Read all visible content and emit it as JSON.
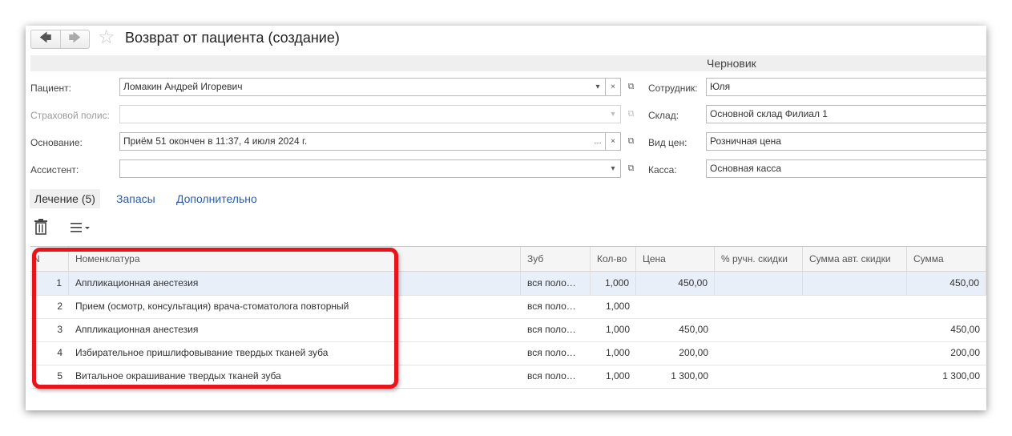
{
  "header": {
    "title": "Возврат от пациента (создание)",
    "status": "Черновик"
  },
  "form": {
    "patient": {
      "label": "Пациент:",
      "value": "Ломакин Андрей Игоревич"
    },
    "policy": {
      "label": "Страховой полис:",
      "value": ""
    },
    "basis": {
      "label": "Основание:",
      "value": "Приём 51 окончен в 11:37, 4 июля 2024 г."
    },
    "assistant": {
      "label": "Ассистент:",
      "value": ""
    },
    "employee": {
      "label": "Сотрудник:",
      "value": "Юля"
    },
    "warehouse": {
      "label": "Склад:",
      "value": "Основной склад Филиал 1"
    },
    "price_type": {
      "label": "Вид цен:",
      "value": "Розничная цена"
    },
    "cashbox": {
      "label": "Касса:",
      "value": "Основная касса"
    }
  },
  "tabs": [
    {
      "label": "Лечение (5)"
    },
    {
      "label": "Запасы"
    },
    {
      "label": "Дополнительно"
    }
  ],
  "table": {
    "columns": [
      "N",
      "Номенклатура",
      "Зуб",
      "Кол-во",
      "Цена",
      "% ручн. скидки",
      "Сумма авт. скидки",
      "Сумма"
    ],
    "rows": [
      {
        "n": "1",
        "name": "Аппликационная анестезия",
        "tooth": "вся поло…",
        "qty": "1,000",
        "price": "450,00",
        "manual_discount": "",
        "auto_discount": "",
        "sum": "450,00"
      },
      {
        "n": "2",
        "name": "Прием (осмотр, консультация) врача-стоматолога повторный",
        "tooth": "вся поло…",
        "qty": "1,000",
        "price": "",
        "manual_discount": "",
        "auto_discount": "",
        "sum": ""
      },
      {
        "n": "3",
        "name": "Аппликационная анестезия",
        "tooth": "вся поло…",
        "qty": "1,000",
        "price": "450,00",
        "manual_discount": "",
        "auto_discount": "",
        "sum": "450,00"
      },
      {
        "n": "4",
        "name": "Избирательное пришлифовывание твердых тканей зуба",
        "tooth": "вся поло…",
        "qty": "1,000",
        "price": "200,00",
        "manual_discount": "",
        "auto_discount": "",
        "sum": "200,00"
      },
      {
        "n": "5",
        "name": "Витальное окрашивание твердых тканей зуба",
        "tooth": "вся поло…",
        "qty": "1,000",
        "price": "1 300,00",
        "manual_discount": "",
        "auto_discount": "",
        "sum": "1 300,00"
      }
    ]
  },
  "colors": {
    "highlight": "#e8141b",
    "link": "#2b5ca8",
    "selected_row": "#e8eff9"
  }
}
